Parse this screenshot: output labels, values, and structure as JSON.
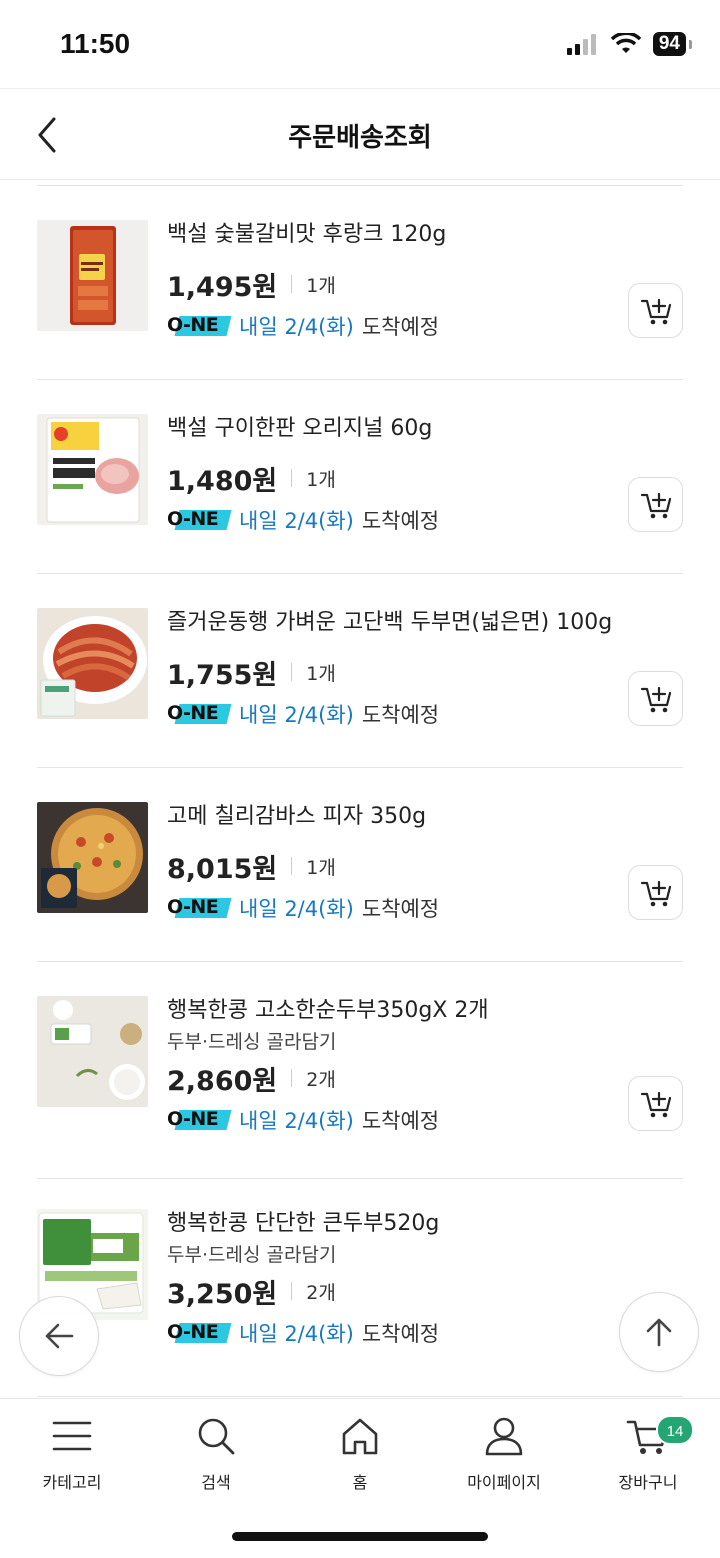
{
  "status": {
    "time": "11:50",
    "battery": "94"
  },
  "header": {
    "title": "주문배송조회"
  },
  "items": [
    {
      "name": "백설 숯불갈비맛 후랑크 120g",
      "sub": "",
      "price": "1,495원",
      "qty": "1개",
      "ship_date": "내일 2/4(화)",
      "ship_status": "도착예정"
    },
    {
      "name": "백설 구이한판 오리지널 60g",
      "sub": "",
      "price": "1,480원",
      "qty": "1개",
      "ship_date": "내일 2/4(화)",
      "ship_status": "도착예정"
    },
    {
      "name": "즐거운동행 가벼운 고단백 두부면(넓은면) 100g",
      "sub": "",
      "price": "1,755원",
      "qty": "1개",
      "ship_date": "내일 2/4(화)",
      "ship_status": "도착예정"
    },
    {
      "name": "고메 칠리감바스 피자 350g",
      "sub": "",
      "price": "8,015원",
      "qty": "1개",
      "ship_date": "내일 2/4(화)",
      "ship_status": "도착예정"
    },
    {
      "name": "행복한콩 고소한순두부350gX 2개",
      "sub": "두부·드레싱 골라담기",
      "price": "2,860원",
      "qty": "2개",
      "ship_date": "내일 2/4(화)",
      "ship_status": "도착예정"
    },
    {
      "name": "행복한콩 단단한 큰두부520g",
      "sub": "두부·드레싱 골라담기",
      "price": "3,250원",
      "qty": "2개",
      "ship_date": "내일 2/4(화)",
      "ship_status": "도착예정"
    }
  ],
  "one_logo": "O-NE",
  "nav": {
    "category": "카테고리",
    "search": "검색",
    "home": "홈",
    "mypage": "마이페이지",
    "cart": "장바구니",
    "cart_count": "14"
  },
  "colors": {
    "accent_blue": "#1878c2",
    "one_cyan": "#2cc7e0",
    "badge_green": "#23a671"
  }
}
